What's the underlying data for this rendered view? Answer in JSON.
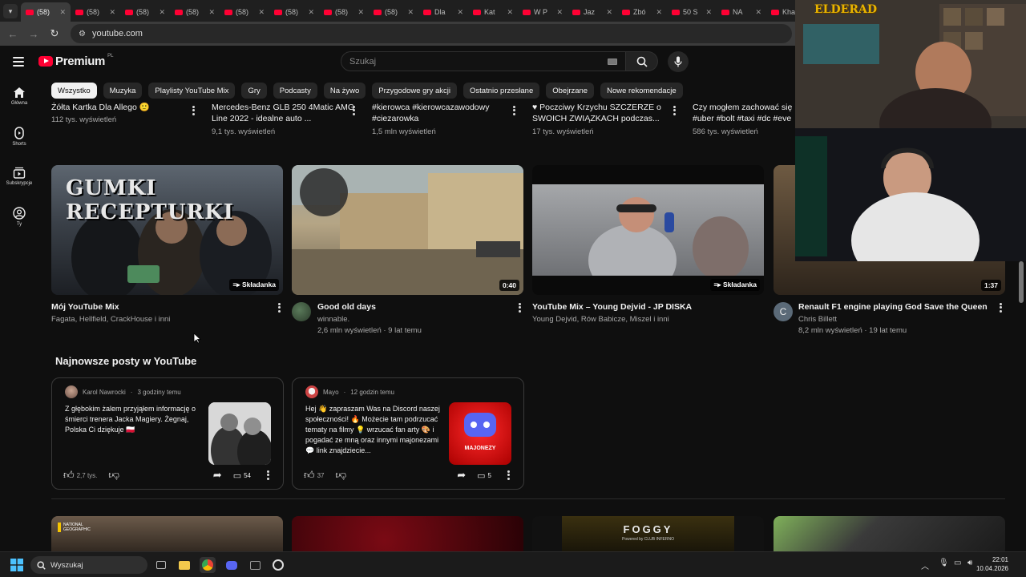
{
  "browser": {
    "tabs": [
      {
        "label": "(58)",
        "active": true
      },
      {
        "label": "(58)"
      },
      {
        "label": "(58)"
      },
      {
        "label": "(58)"
      },
      {
        "label": "(58)"
      },
      {
        "label": "(58)"
      },
      {
        "label": "(58)"
      },
      {
        "label": "(58)"
      },
      {
        "label": "Dla"
      },
      {
        "label": "Kat"
      },
      {
        "label": "W P"
      },
      {
        "label": "Jaz"
      },
      {
        "label": "Zbó"
      },
      {
        "label": "50 S"
      },
      {
        "label": "NA"
      },
      {
        "label": "Kha"
      }
    ],
    "url": "youtube.com"
  },
  "youtube": {
    "logo_text": "Premium",
    "logo_sup": "PL",
    "search_placeholder": "Szukaj",
    "rail": [
      {
        "label": "Główna",
        "icon": "home-icon"
      },
      {
        "label": "Shorts",
        "icon": "shorts-icon"
      },
      {
        "label": "Subskrypcje",
        "icon": "subscriptions-icon"
      },
      {
        "label": "Ty",
        "icon": "you-icon"
      }
    ],
    "chips": [
      "Wszystko",
      "Muzyka",
      "Playlisty YouTube Mix",
      "Gry",
      "Podcasty",
      "Na żywo",
      "Przygodowe gry akcji",
      "Ostatnio przesłane",
      "Obejrzane",
      "Nowe rekomendacje"
    ],
    "top_row": [
      {
        "title": "Żółta Kartka Dla Allego 🙂",
        "meta": "112 tys. wyświetleń"
      },
      {
        "title": "Mercedes-Benz GLB 250 4Matic AMG Line 2022 - idealne auto ...",
        "meta": "9,1 tys. wyświetleń"
      },
      {
        "title": "#kierowca #kierowcazawodowy #ciezarowka",
        "meta": "1,5 mln wyświetleń"
      },
      {
        "title": "♥ Poczciwy Krzychu SZCZERZE o SWOICH ZWIĄZKACH podczas...",
        "meta": "17 tys. wyświetleń"
      },
      {
        "title": "Czy mogłem zachować się #uber #bolt #taxi #dc #eve",
        "meta": "586 tys. wyświetleń"
      }
    ],
    "videos": [
      {
        "title": "Mój YouTube Mix",
        "meta1": "Fagata, Hellfield, CrackHouse i inni",
        "meta2": "",
        "badge": "Składanka",
        "thumb_text": "GUMKI RECEPTURKI"
      },
      {
        "title": "Good old days",
        "meta1": "winnable.",
        "meta2": "2,6 mln wyświetleń · 9 lat temu",
        "badge": "0:40"
      },
      {
        "title": "YouTube Mix – Young Dejvid - JP DISKA",
        "meta1": "Young Dejvid, Rów Babicze, Miszel i inni",
        "meta2": "",
        "badge": "Składanka"
      },
      {
        "title": "Renault F1 engine playing God Save the Queen",
        "meta1": "Chris Billett",
        "meta2": "8,2 mln wyświetleń · 19 lat temu",
        "badge": "1:37",
        "avatar_letter": "C"
      }
    ],
    "posts_section_title": "Najnowsze posty w YouTube",
    "posts": [
      {
        "author": "Karol Nawrocki",
        "time": "3 godziny temu",
        "text": "Z głębokim żalem przyjąłem informację o śmierci trenera Jacka Magiery. Żegnaj, Polska Ci dziękuje 🇵🇱",
        "likes": "2,7 tys.",
        "comments": "54"
      },
      {
        "author": "Mayo",
        "time": "12 godzin temu",
        "text": "Hej 👋 zapraszam Was na Discord naszej społeczności! 🔥 Możecie tam podrzucać tematy na filmy 💡 wrzucać fan arty 🎨 i pogadać ze mną oraz innymi majonezami 💬 link znajdziecie...",
        "likes": "37",
        "comments": "5",
        "image_label": "MAJONEZY"
      }
    ],
    "bottom_row": [
      {
        "label": "NATIONAL GEOGRAPHIC"
      },
      {
        "label": ""
      },
      {
        "label": "FOGGY",
        "sub": "Powered by CLUB INFERNO"
      },
      {
        "label": ""
      }
    ]
  },
  "taskbar": {
    "search_placeholder": "Wyszukaj",
    "time": "22:01",
    "date": "10.04.2026"
  },
  "overlay": {
    "stream_logo": "ELDERAD"
  },
  "colors": {
    "accent": "#ff0033",
    "background": "#0f0f0f",
    "chip": "#272727"
  }
}
